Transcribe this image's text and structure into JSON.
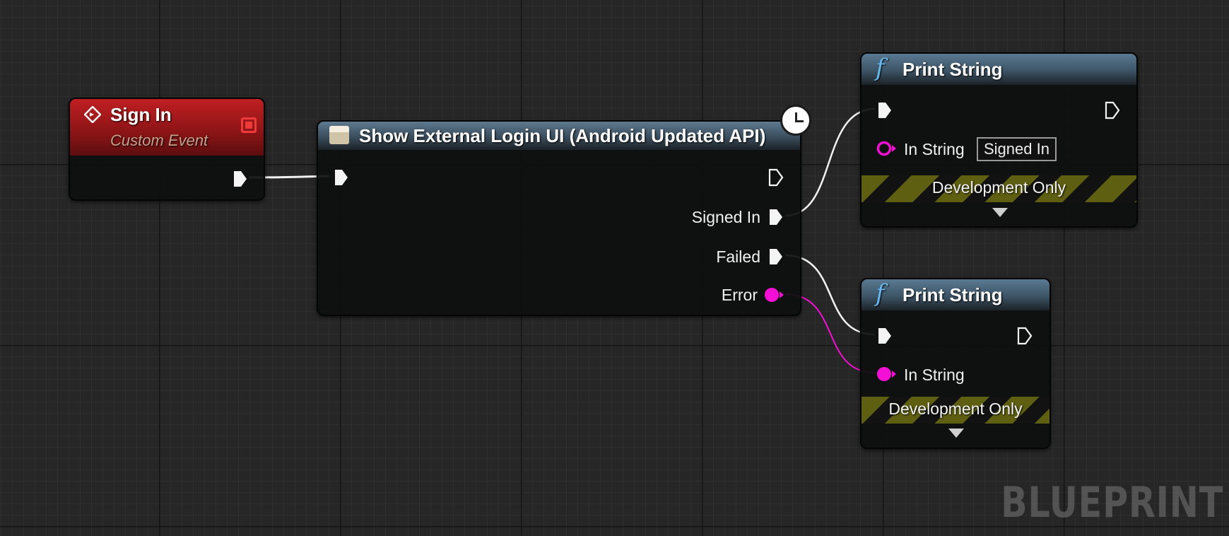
{
  "graph": {
    "watermark": "BLUEPRINT"
  },
  "nodes": {
    "sign_in_event": {
      "title": "Sign In",
      "subtitle": "Custom Event",
      "header_color": "#a0191c",
      "icon": "event-diamond-icon"
    },
    "show_login": {
      "title": "Show External Login UI (Android Updated API)",
      "header_color": "#4a6478",
      "icon": "document-icon",
      "latent_icon": "clock-icon",
      "outputs": {
        "signed_in": "Signed In",
        "failed": "Failed",
        "error": "Error"
      }
    },
    "print_string_1": {
      "title": "Print String",
      "icon": "function-icon",
      "in_string_label": "In String",
      "in_string_value": "Signed In",
      "dev_only": "Development Only"
    },
    "print_string_2": {
      "title": "Print String",
      "icon": "function-icon",
      "in_string_label": "In String",
      "dev_only": "Development Only"
    }
  },
  "colors": {
    "exec_pin": "#ffffff",
    "string_pin": "#f30fd3",
    "event_header": "#a0191c",
    "function_accent": "#68b7ec",
    "dev_band": "#5f5f12"
  }
}
